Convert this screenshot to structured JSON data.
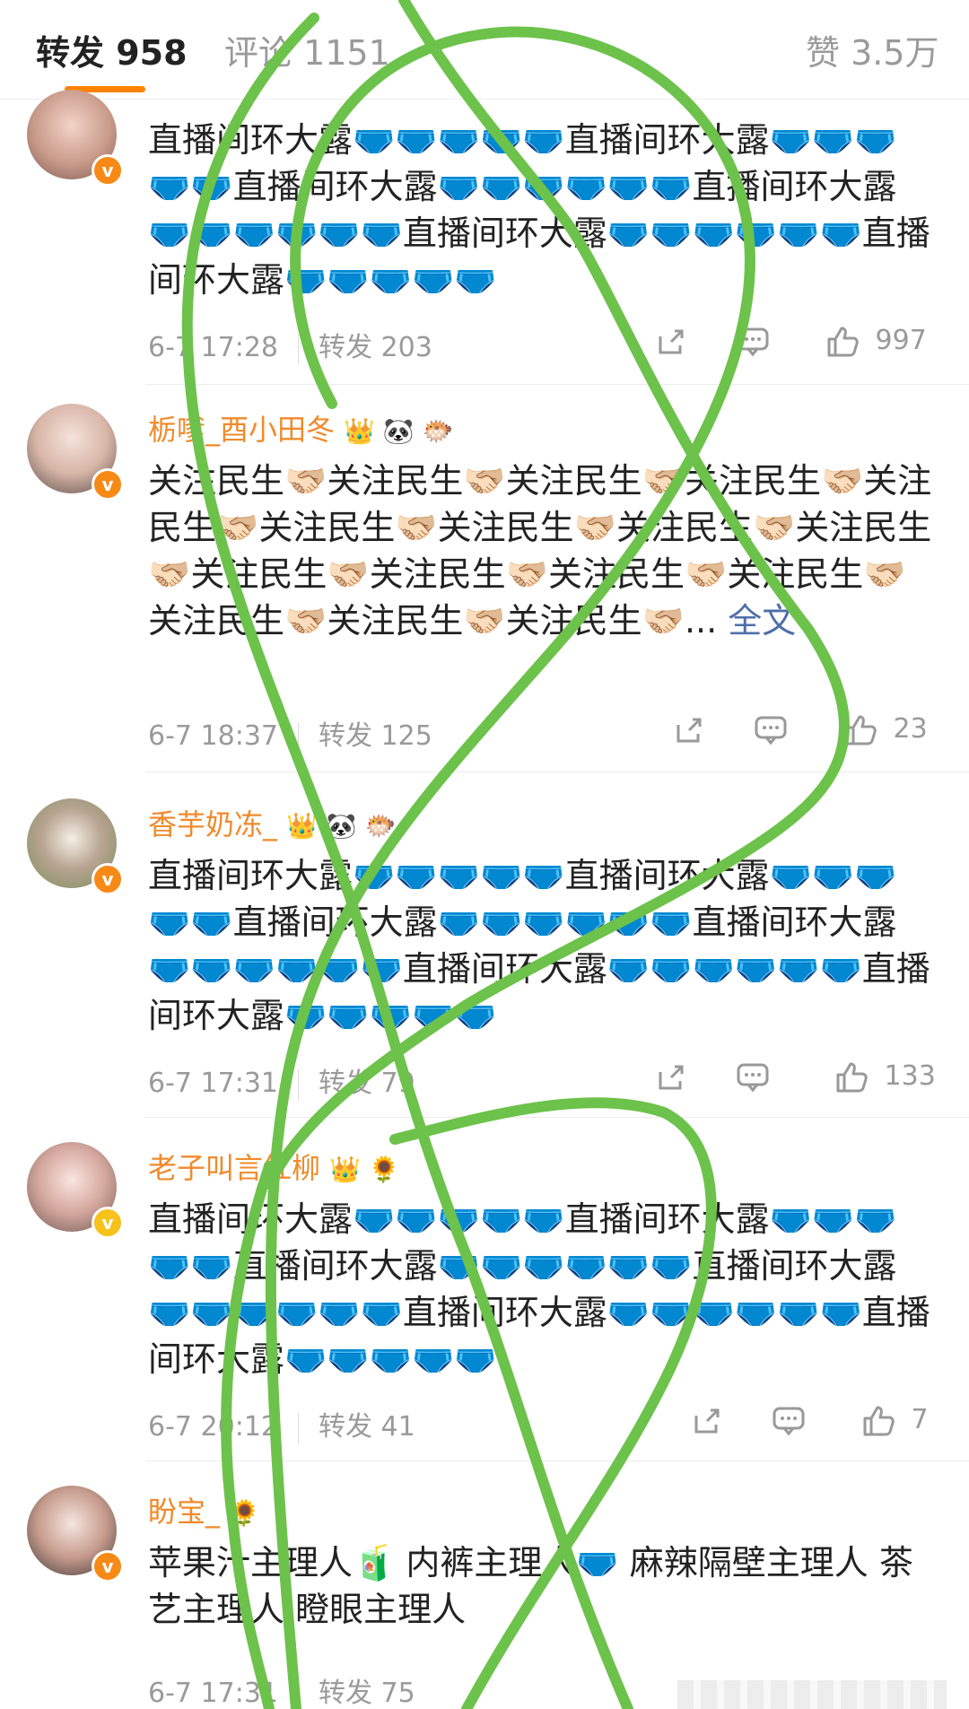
{
  "tabs": [
    {
      "label": "转发 958",
      "active": true
    },
    {
      "label": "评论 1151",
      "active": false
    },
    {
      "label": "赞 3.5万",
      "active": false
    }
  ],
  "posts": [
    {
      "username": "",
      "content": "直播间环大露🩲🩲🩲🩲🩲直播间环大露🩲🩲🩲🩲🩲直播间环大露🩲🩲🩲🩲🩲🩲直播间环大露🩲🩲🩲🩲🩲🩲直播间环大露🩲🩲🩲🩲🩲🩲直播间环大露🩲🩲🩲🩲🩲",
      "date": "6-7 17:28",
      "repost": "转发 203",
      "likes": "997",
      "verified_color": "#f78a16"
    },
    {
      "username": "栃嗲_酉小田冬",
      "tags": "👑 🐼 🐡",
      "content": "关注民生🫱🏻‍🫲🏼关注民生🫱🏻‍🫲🏼关注民生🫱🏻‍🫲🏼关注民生🫱🏻‍🫲🏼关注民生🫱🏻‍🫲🏼关注民生🫱🏻‍🫲🏼关注民生🫱🏻‍🫲🏼关注民生🫱🏻‍🫲🏼关注民生🫱🏻‍🫲🏼关注民生🫱🏻‍🫲🏼关注民生🫱🏻‍🫲🏼关注民生🫱🏻‍🫲🏼关注民生🫱🏻‍🫲🏼关注民生🫱🏻‍🫲🏼关注民生🫱🏻‍🫲🏼关注民生🫱🏻‍🫲🏼...",
      "more": "全文",
      "date": "6-7 18:37",
      "repost": "转发 125",
      "likes": "23",
      "verified_color": "#f78a16"
    },
    {
      "username": "香芋奶冻_",
      "tags": "👑 🐼 🐡",
      "content": "直播间环大露🩲🩲🩲🩲🩲直播间环大露🩲🩲🩲🩲🩲直播间环大露🩲🩲🩲🩲🩲🩲直播间环大露🩲🩲🩲🩲🩲🩲直播间环大露🩲🩲🩲🩲🩲🩲直播间环大露🩲🩲🩲🩲🩲",
      "date": "6-7 17:31",
      "repost": "转发 79",
      "likes": "133",
      "verified_color": "#f78a16"
    },
    {
      "username": "老子叫言红柳",
      "tags": "👑 🌻",
      "content": "直播间环大露🩲🩲🩲🩲🩲直播间环大露🩲🩲🩲🩲🩲直播间环大露🩲🩲🩲🩲🩲🩲直播间环大露🩲🩲🩲🩲🩲🩲直播间环大露🩲🩲🩲🩲🩲🩲直播间环大露🩲🩲🩲🩲🩲",
      "date": "6-7 20:12",
      "repost": "转发 41",
      "likes": "7",
      "verified_color": "#f6c21b"
    },
    {
      "username": "盼宝_",
      "tags": "🌻",
      "content": "苹果汁主理人🧃 内裤主理人🩲 麻辣隔壁主理人 茶艺主理人 瞪眼主理人",
      "date": "6-7 17:31",
      "repost": "转发 75",
      "likes": "",
      "verified_color": "#f78a16"
    }
  ],
  "colors": {
    "accent": "#ff8200",
    "username": "#f08a2b",
    "link": "#4d6fa8",
    "scribble": "#6cc24a"
  },
  "icons": [
    "share-icon",
    "comment-icon",
    "like-icon"
  ]
}
